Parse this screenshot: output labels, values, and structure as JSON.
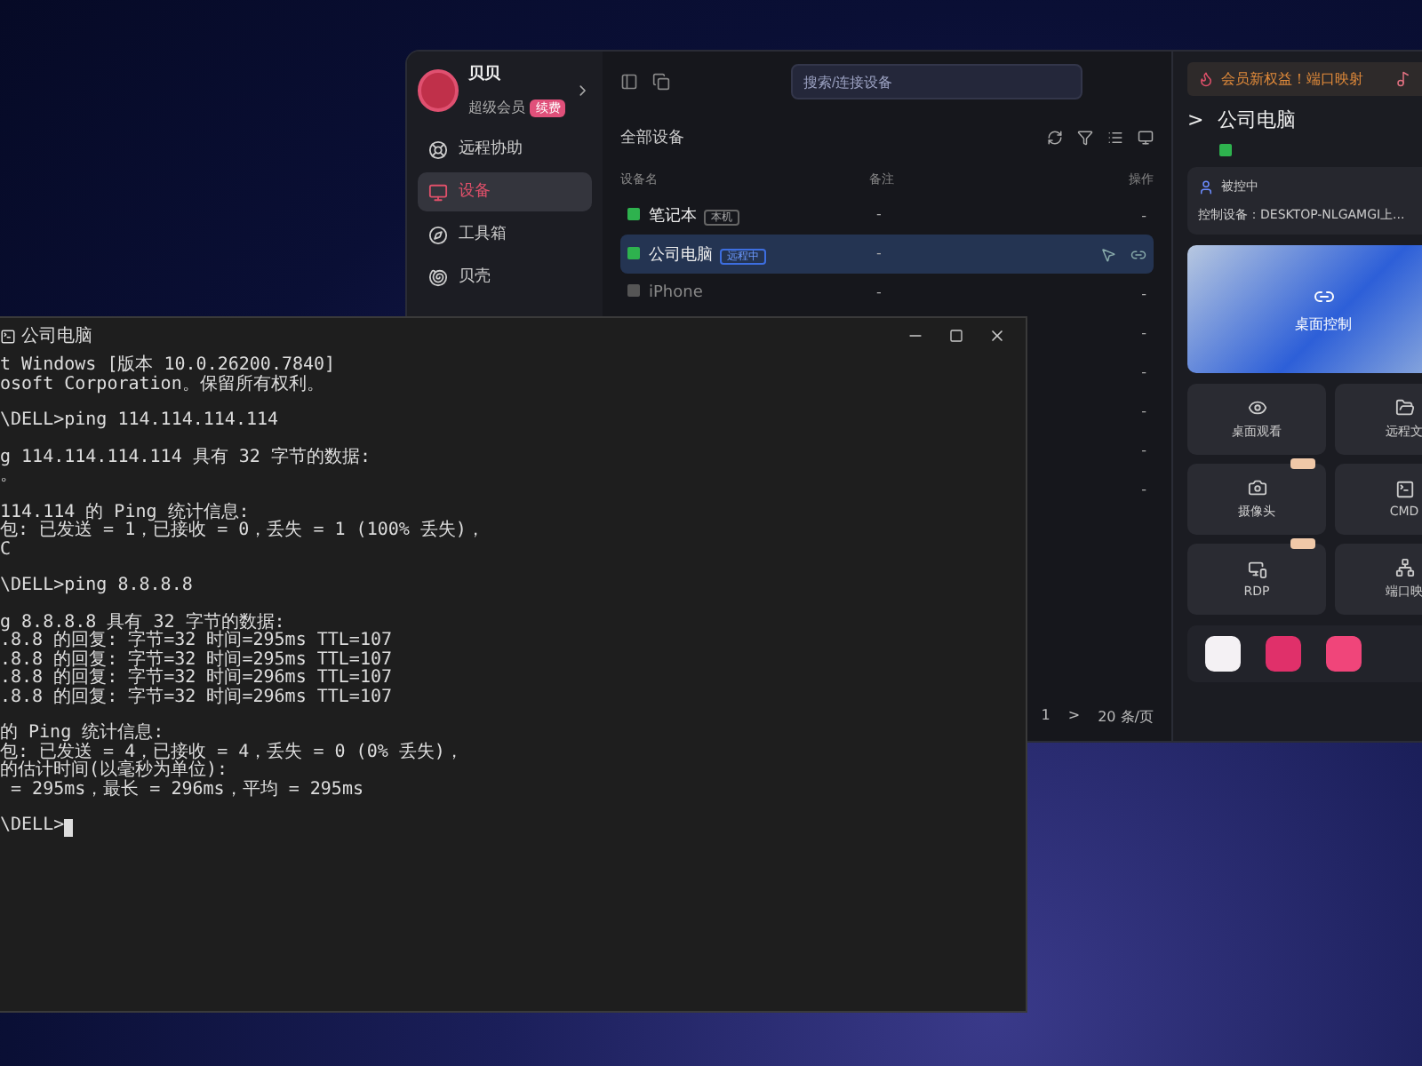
{
  "app_window": {
    "user": {
      "name": "贝贝",
      "tier": "超级会员",
      "badge": "续费"
    },
    "sidebar": {
      "items": [
        {
          "label": "远程协助",
          "selected": false
        },
        {
          "label": "设备",
          "selected": true
        },
        {
          "label": "工具箱",
          "selected": false
        },
        {
          "label": "贝壳",
          "selected": false
        }
      ]
    },
    "search": {
      "placeholder": "搜索/连接设备"
    },
    "promo": "会员新权益！端口映射",
    "device_list": {
      "title": "全部设备",
      "columns": [
        "设备名",
        "备注",
        "操作"
      ],
      "rows": [
        {
          "name": "笔记本",
          "badge": {
            "text": "本机",
            "kind": "local"
          },
          "online": true,
          "selected": false,
          "note": "-",
          "operation": "-"
        },
        {
          "name": "公司电脑",
          "badge": {
            "text": "远程中",
            "kind": "remote"
          },
          "online": true,
          "selected": true,
          "note": "-"
        },
        {
          "name": "iPhone",
          "online": false,
          "selected": false,
          "note": "-",
          "operation": "-"
        },
        {
          "operation": "-",
          "selected": false
        },
        {
          "operation": "-",
          "selected": false
        },
        {
          "operation": "-",
          "selected": false
        },
        {
          "operation": "-",
          "selected": false
        },
        {
          "operation": "-",
          "selected": false
        }
      ],
      "pagination": {
        "page": "1",
        "next": ">",
        "page_size": "20 条/页"
      }
    },
    "detail": {
      "back": ">",
      "title": "公司电脑",
      "online": true,
      "status": "被控中",
      "control_device": "控制设备：DESKTOP-NLGAMGI上...",
      "preview_label": "桌面控制",
      "tiles": [
        {
          "label": "桌面观看",
          "vip": false
        },
        {
          "label": "远程文",
          "vip": false
        },
        {
          "label": "摄像头",
          "vip": true
        },
        {
          "label": "CMD",
          "vip": false
        },
        {
          "label": "RDP",
          "vip": true
        },
        {
          "label": "端口映",
          "vip": false
        }
      ],
      "apps": [
        {
          "color": "#f4f1f4"
        },
        {
          "color": "#e0306a"
        },
        {
          "color": "#f0457a"
        }
      ]
    }
  },
  "cmd_window": {
    "title": "公司电脑",
    "blocks": [
      [
        "t Windows [版本 10.0.26200.7840]",
        "osoft Corporation。保留所有权利。"
      ],
      [
        "\\DELL>ping 114.114.114.114"
      ],
      [
        "g 114.114.114.114 具有 32 字节的数据:",
        "。"
      ],
      [
        "114.114 的 Ping 统计信息:",
        "包: 已发送 = 1，已接收 = 0，丢失 = 1 (100% 丢失)，",
        "C"
      ],
      [
        "\\DELL>ping 8.8.8.8"
      ],
      [
        "g 8.8.8.8 具有 32 字节的数据:",
        ".8.8 的回复: 字节=32 时间=295ms TTL=107",
        ".8.8 的回复: 字节=32 时间=295ms TTL=107",
        ".8.8 的回复: 字节=32 时间=296ms TTL=107",
        ".8.8 的回复: 字节=32 时间=296ms TTL=107"
      ],
      [
        "的 Ping 统计信息:",
        "包: 已发送 = 4，已接收 = 4，丢失 = 0 (0% 丢失)，",
        "的估计时间(以毫秒为单位):",
        " = 295ms，最长 = 296ms，平均 = 295ms"
      ],
      [
        "\\DELL>"
      ]
    ]
  }
}
